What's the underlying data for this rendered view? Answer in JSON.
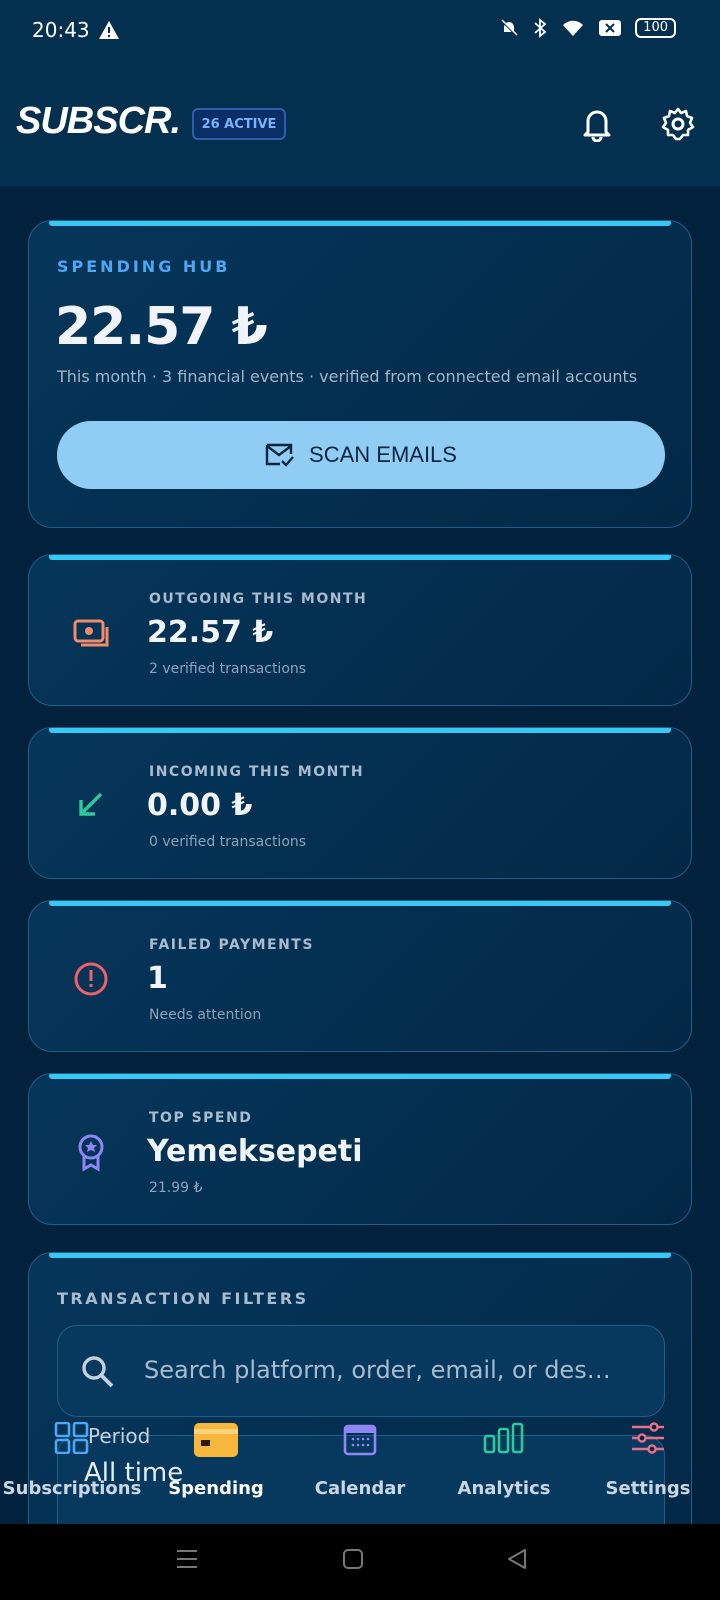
{
  "status": {
    "time": "20:43",
    "battery": "100"
  },
  "header": {
    "logo": "SUBSCR.",
    "badge": "26 ACTIVE"
  },
  "hub": {
    "label": "SPENDING HUB",
    "amount": "22.57 ₺",
    "subtitle": "This month · 3 financial events · verified from connected email accounts",
    "scan_label": "SCAN EMAILS"
  },
  "stats": [
    {
      "label": "OUTGOING THIS MONTH",
      "value": "22.57 ₺",
      "sub": "2 verified transactions",
      "color": "#f28b6a"
    },
    {
      "label": "INCOMING THIS MONTH",
      "value": "0.00 ₺",
      "sub": "0 verified transactions",
      "color": "#2ec99b"
    },
    {
      "label": "FAILED PAYMENTS",
      "value": "1",
      "sub": "Needs attention",
      "color": "#f0606a"
    },
    {
      "label": "TOP SPEND",
      "value": "Yemeksepeti",
      "sub": "21.99 ₺",
      "color": "#8f86f5"
    }
  ],
  "filters": {
    "label": "TRANSACTION FILTERS",
    "search_placeholder": "Search platform, order, email, or des…",
    "period_label": "Period",
    "period_value": "All time"
  },
  "nav": [
    {
      "label": "Subscriptions",
      "icon": "grid-icon"
    },
    {
      "label": "Spending",
      "icon": "card-icon",
      "active": true
    },
    {
      "label": "Calendar",
      "icon": "calendar-icon"
    },
    {
      "label": "Analytics",
      "icon": "bar-chart-icon"
    },
    {
      "label": "Settings",
      "icon": "sliders-icon"
    }
  ],
  "colors": {
    "accent": "#38c8f4",
    "button": "#90cdf4",
    "background": "#02213d"
  }
}
